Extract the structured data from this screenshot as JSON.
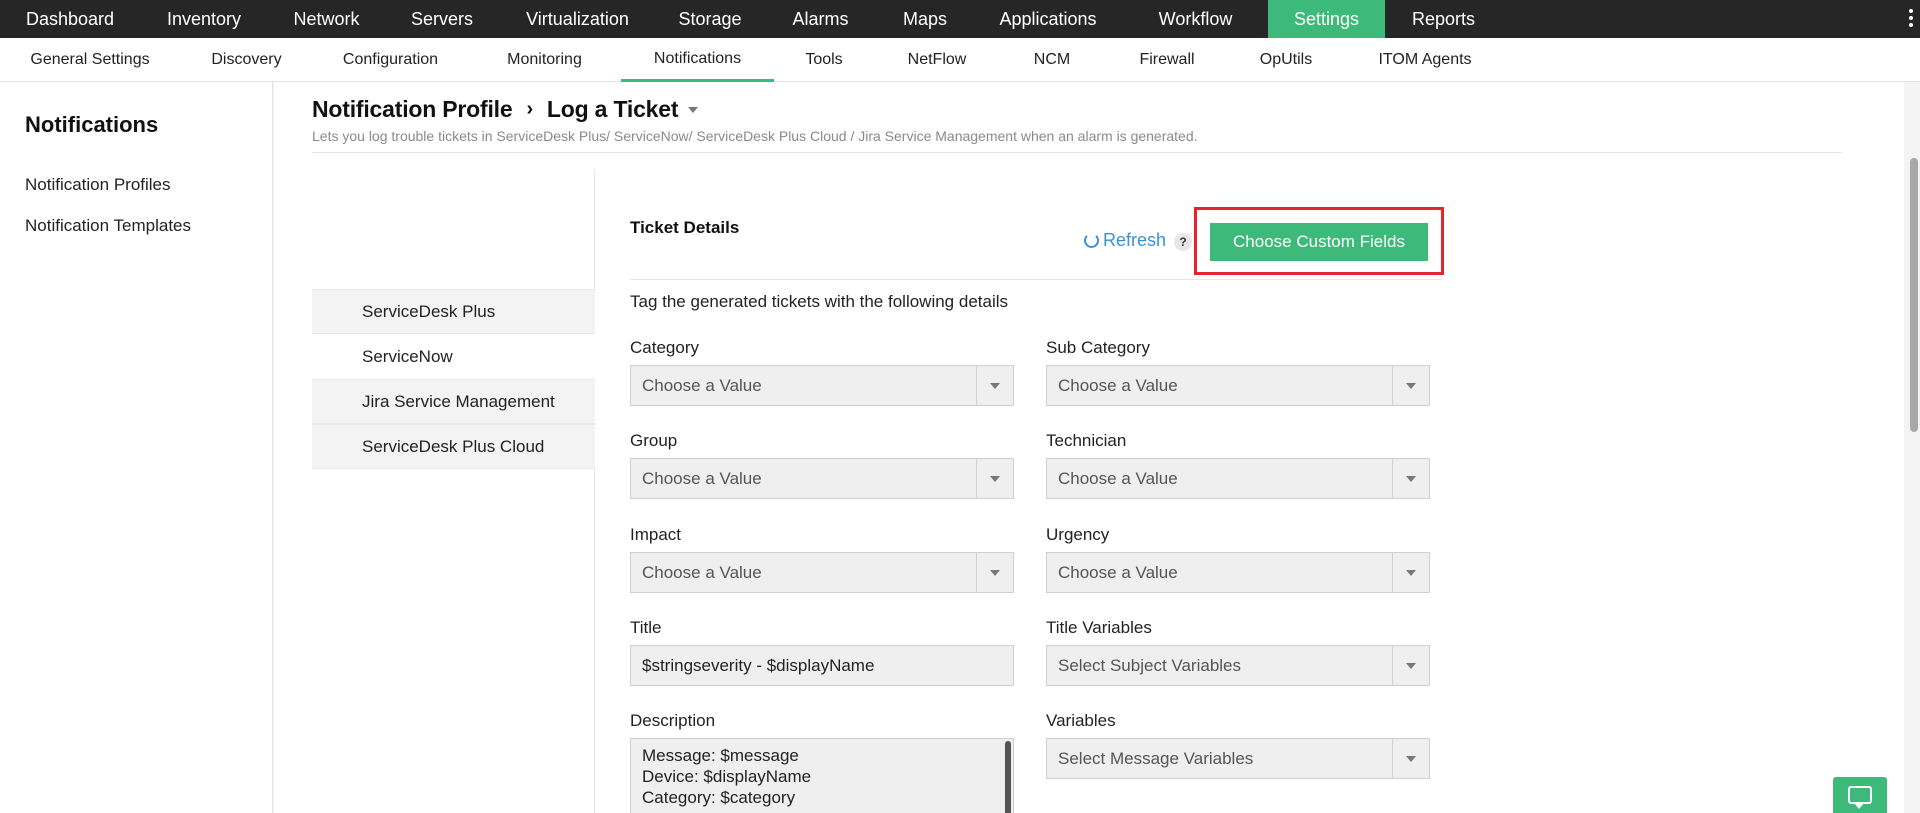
{
  "top_nav": {
    "items": [
      {
        "label": "Dashboard"
      },
      {
        "label": "Inventory"
      },
      {
        "label": "Network"
      },
      {
        "label": "Servers"
      },
      {
        "label": "Virtualization"
      },
      {
        "label": "Storage"
      },
      {
        "label": "Alarms"
      },
      {
        "label": "Maps"
      },
      {
        "label": "Applications"
      },
      {
        "label": "Workflow"
      },
      {
        "label": "Settings",
        "active": true
      },
      {
        "label": "Reports"
      }
    ]
  },
  "sub_nav": {
    "items": [
      {
        "label": "General Settings"
      },
      {
        "label": "Discovery"
      },
      {
        "label": "Configuration"
      },
      {
        "label": "Monitoring"
      },
      {
        "label": "Notifications",
        "active": true
      },
      {
        "label": "Tools"
      },
      {
        "label": "NetFlow"
      },
      {
        "label": "NCM"
      },
      {
        "label": "Firewall"
      },
      {
        "label": "OpUtils"
      },
      {
        "label": "ITOM Agents"
      }
    ]
  },
  "sidebar": {
    "title": "Notifications",
    "links": [
      {
        "label": "Notification Profiles"
      },
      {
        "label": "Notification Templates"
      }
    ]
  },
  "page": {
    "breadcrumb_root": "Notification Profile",
    "breadcrumb_current": "Log a Ticket",
    "subtitle": "Lets you log trouble tickets in ServiceDesk Plus/ ServiceNow/ ServiceDesk Plus Cloud / Jira Service Management when an alarm is generated."
  },
  "ticket_tabs": [
    {
      "label": "ServiceDesk Plus"
    },
    {
      "label": "ServiceNow",
      "selected": true
    },
    {
      "label": "Jira Service Management"
    },
    {
      "label": "ServiceDesk Plus Cloud"
    }
  ],
  "ticket_details": {
    "title": "Ticket Details",
    "refresh_label": "Refresh",
    "help_label": "?",
    "custom_fields_button": "Choose Custom Fields",
    "tagline": "Tag the generated tickets with the following details",
    "fields": {
      "category": {
        "label": "Category",
        "value": "Choose a Value"
      },
      "sub_category": {
        "label": "Sub Category",
        "value": "Choose a Value"
      },
      "group": {
        "label": "Group",
        "value": "Choose a Value"
      },
      "technician": {
        "label": "Technician",
        "value": "Choose a Value"
      },
      "impact": {
        "label": "Impact",
        "value": "Choose a Value"
      },
      "urgency": {
        "label": "Urgency",
        "value": "Choose a Value"
      },
      "title": {
        "label": "Title",
        "value": "$stringseverity - $displayName"
      },
      "title_variables": {
        "label": "Title Variables",
        "value": "Select Subject Variables"
      },
      "description": {
        "label": "Description",
        "lines": [
          "Message: $message",
          "Device: $displayName",
          "Category: $category"
        ]
      },
      "variables": {
        "label": "Variables",
        "value": "Select Message Variables"
      }
    }
  },
  "colors": {
    "accent": "#3dba7a",
    "nav_bg": "#262626",
    "highlight": "#e3262d",
    "link": "#3a92d6"
  }
}
